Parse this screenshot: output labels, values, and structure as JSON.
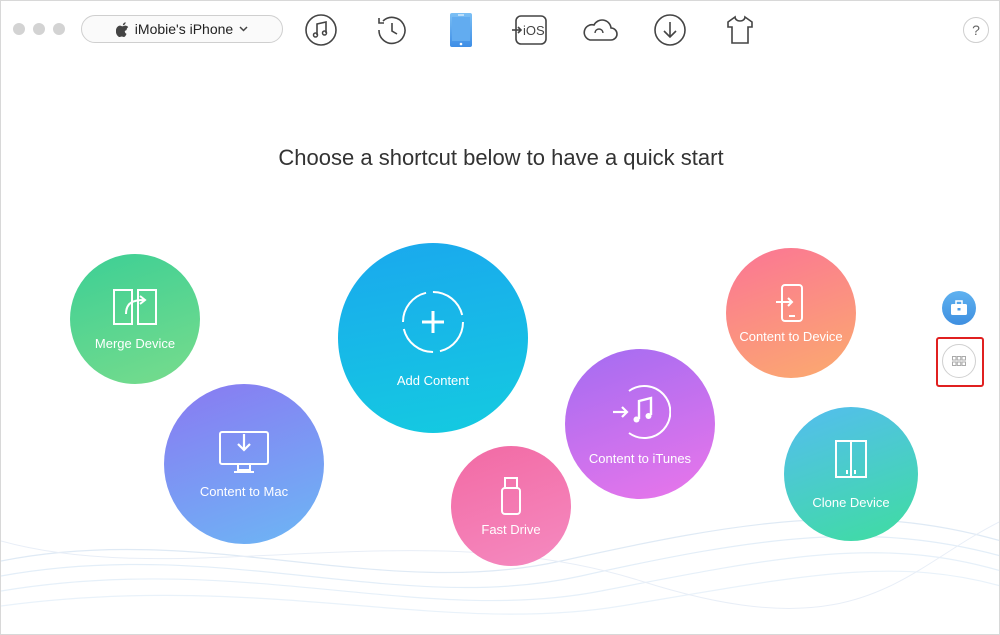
{
  "toolbar": {
    "device_name": "iMobie's iPhone",
    "icons": [
      "music-icon",
      "history-icon",
      "iphone-icon",
      "ios-transfer-icon",
      "icloud-icon",
      "download-icon",
      "tshirt-icon"
    ],
    "ios_label": "iOS",
    "help_label": "?"
  },
  "main": {
    "heading": "Choose a shortcut below to have a quick start",
    "shortcuts": {
      "merge": "Merge Device",
      "content_to_mac": "Content to Mac",
      "add_content": "Add Content",
      "fast_drive": "Fast Drive",
      "content_to_itunes": "Content to iTunes",
      "content_to_device": "Content to Device",
      "clone_device": "Clone Device"
    }
  },
  "colors": {
    "accent": "#4aa3ea",
    "highlight": "#e02020"
  }
}
